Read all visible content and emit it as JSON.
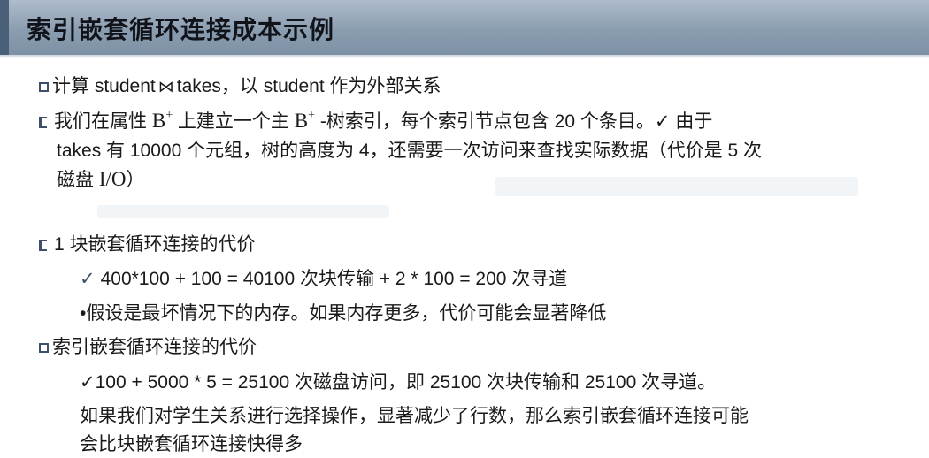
{
  "title": "索引嵌套循环连接成本示例",
  "items": {
    "i1": {
      "text_a": "计算 student",
      "join_symbol": "⋈",
      "text_b": "takes，以 student 作为外部关系"
    },
    "i2": {
      "line1_a": "我们在属性 ",
      "attr_b": "B",
      "sup_plus": "+",
      "line1_b": " 上建立一个主 ",
      "attr_b2": "B",
      "sup_plus2": "+",
      "line1_c": " -树索引，每个索引节点包含 20 个条目。",
      "check": "✓",
      "line1_d": " 由于",
      "line2": "takes 有 10000 个元组，树的高度为 4，还需要一次访问来查找实际数据（代价是 5 次",
      "line3_a": "磁盘 ",
      "io": "I/O",
      "line3_b": "）"
    },
    "i3": {
      "heading": "1 块嵌套循环连接的代价",
      "check": "✓",
      "detail": "400*100 + 100 = 40100 次块传输 + 2 * 100 = 200 次寻道",
      "note": "•假设是最坏情况下的内存。如果内存更多，代价可能会显著降低"
    },
    "i4": {
      "heading": "索引嵌套循环连接的代价",
      "check": "✓",
      "detail": "100 + 5000 * 5 = 25100 次磁盘访问，即 25100 次块传输和 25100 次寻道。",
      "note_line1": "如果我们对学生关系进行选择操作，显著减少了行数，那么索引嵌套循环连接可能",
      "note_line2": "会比块嵌套循环连接快得多"
    }
  }
}
